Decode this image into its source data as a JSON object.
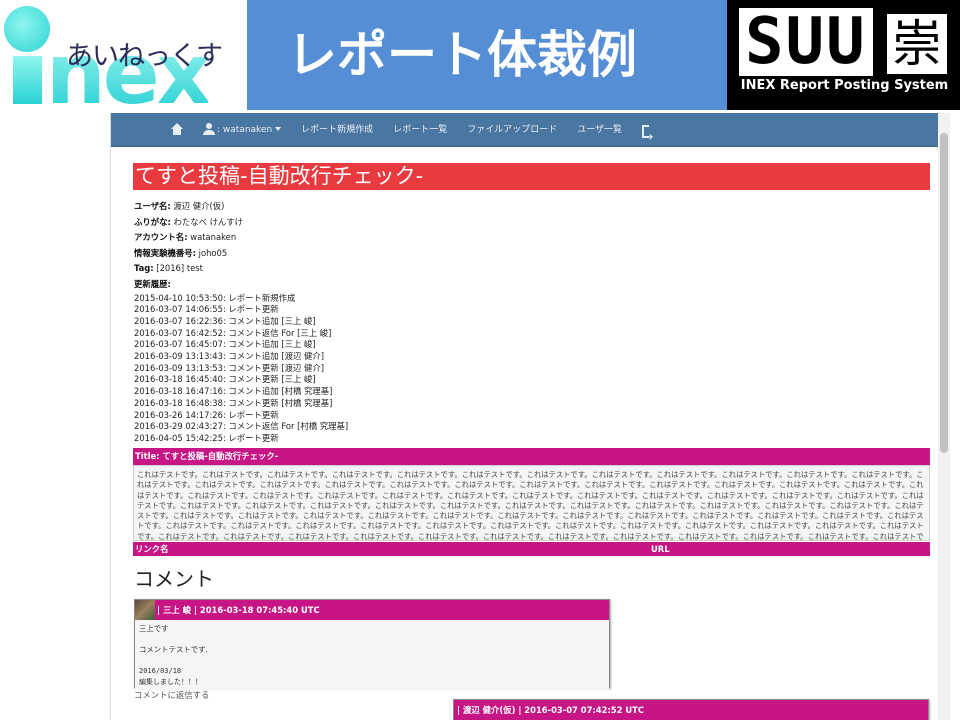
{
  "slide": {
    "logo_kana": "あいねっくす",
    "logo_word": "nex",
    "title": "レポート体裁例",
    "suu_word": "SUU",
    "suu_kanji": "崇",
    "suu_subtitle": "INEX Report Posting System",
    "colors": {
      "title_band": "#558ed5",
      "logo_cyan": "#34d6d6"
    }
  },
  "navbar": {
    "user": ": watanaken",
    "items": [
      "レポート新規作成",
      "レポート一覧",
      "ファイルアップロード",
      "ユーザ一覧"
    ],
    "icons": [
      "home-icon",
      "user-icon",
      "logout-icon"
    ]
  },
  "report": {
    "title": "てすと投稿-自動改行チェック-",
    "meta": [
      {
        "label": "ユーザ名:",
        "value": " 渡辺 健介(仮)"
      },
      {
        "label": "ふりがな:",
        "value": " わたなべ けんすけ"
      },
      {
        "label": "アカウント名:",
        "value": " watanaken"
      },
      {
        "label": "情報実験機番号:",
        "value": " joho05"
      },
      {
        "label": "Tag:",
        "value": " [2016] test"
      }
    ],
    "history_label": "更新履歴:",
    "history": [
      "2015-04-10 10:53:50: レポート新規作成",
      "2016-03-07 14:06:55: レポート更新",
      "2016-03-07 16:22:36: コメント追加 [三上 峻]",
      "2016-03-07 16:42:52: コメント返信 For [三上 峻]",
      "2016-03-07 16:45:07: コメント追加 [三上 峻]",
      "2016-03-09 13:13:43: コメント追加 [渡辺 健介]",
      "2016-03-09 13:13:53: コメント更新 [渡辺 健介]",
      "2016-03-18 16:45:40: コメント更新 [三上 峻]",
      "2016-03-18 16:47:16: コメント追加 [村橋 究理基]",
      "2016-03-18 16:48:38: コメント更新 [村橋 究理基]",
      "2016-03-26 14:17:26: レポート更新",
      "2016-03-29 02:43:27: コメント返信 For [村橋 究理基]",
      "2016-04-05 15:42:25: レポート更新"
    ],
    "body_header": "Title: てすと投稿-自動改行チェック-",
    "body_text": "これはテストです。これはテストです。これはテストです。これはテストです。これはテストです。これはテストです。これはテストです。これはテストです。これはテストです。これはテストです。これはテストです。これはテストです。これはテストです。これはテストです。これはテストです。これはテストです。これはテストです。これはテストです。これはテストです。これはテストです。これはテストです。これはテストです。これはテストです。これはテストです。これはテストです。これはテストです。これはテストです。これはテストです。これはテストです。これはテストです。これはテストです。これはテストです。これはテストです。これはテストです。これはテストです。これはテストです。これはテストです。これはテストです。これはテストです。これはテストです。これはテストです。これはテストです。これはテストです。これはテストです。これはテストです。これはテストです。これはテストです。これはテストです。これはテストです。これはテストです。これはテストです。これはテストです。これはテストです。これはテストです。これはテストです。これはテストです。これはテストです。これはテストです。これはテストです。これはテストです。これはテストです。これはテストです。これはテストです。これはテストです。これはテストです。これはテストです。これはテストです。これはテストです。これはテストです。これはテストです。これはテストです。これはテストです。これはテストです。これはテストです。これはテストです。これはテストです。これはテストです。これはテストです。これはテストです。これはテストです。これはテストです。これはテストです。これはテストです。これはテストです。これはテストです。これはテストです。これはテストです。これはテストです。これはテストです。これはテストです。これはテストです。これはテストです。これはテストです。これはテストです。これはテストです。これはテストです。これはテストです。これはテストです。これはテストです。これはテストです。これはテストです。これはテストです。これはテストです。これはテストです。これはテストです。これはテストです。これはテストです。これはテストです。これはテストです。これはテストです。これはテストです。これはテストです。これはテストです。これはテストです。これはテストです。これはテストです。これはテストです。",
    "link_col_name": "リンク名",
    "link_col_url": "URL",
    "colors": {
      "title_bar": "#e83a3f",
      "section_bar": "#c71585"
    }
  },
  "comments": {
    "section_title": "コメント",
    "first": {
      "header": "| 三上 峻 | 2016-03-18 07:45:40 UTC",
      "lines": [
        "三上です",
        "",
        "コメントテストです."
      ],
      "mono_lines": [
        "2016/03/18",
        "編集しました！！！"
      ]
    },
    "reply_link": "コメントに返信する",
    "second": {
      "header": "| 渡辺 健介(仮) | 2016-03-07 07:42:52 UTC"
    }
  }
}
